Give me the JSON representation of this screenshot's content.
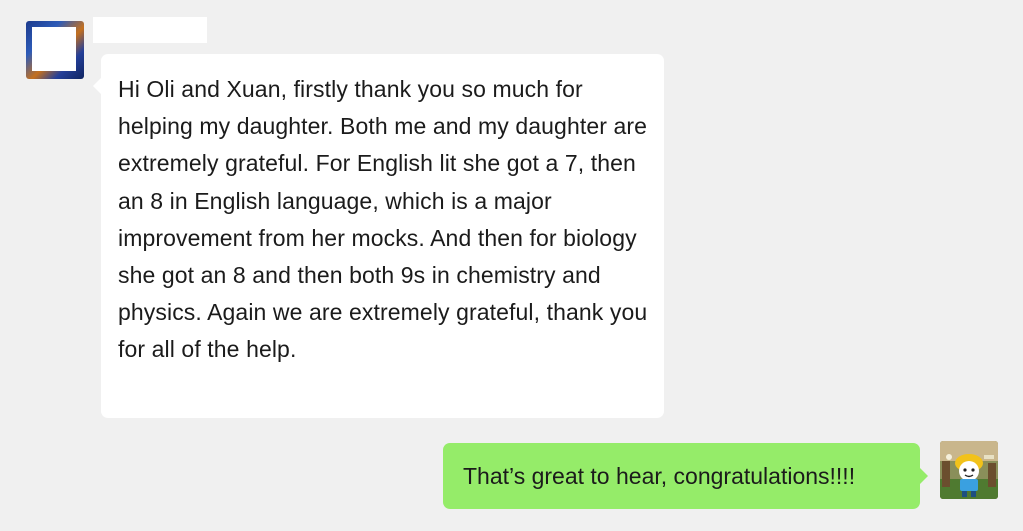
{
  "messages": [
    {
      "direction": "incoming",
      "sender_name": "",
      "text": "Hi Oli and Xuan, firstly thank you so much for helping my daughter. Both me and my daughter are extremely grateful. For English lit she got a 7, then an 8 in English language, which is a major improvement from her mocks. And then for biology she got an 8 and then both 9s in chemistry and physics. Again we are extremely grateful, thank you for all of the help."
    },
    {
      "direction": "outgoing",
      "text": "That’s great to hear, congratulations!!!!"
    }
  ],
  "colors": {
    "background": "#f0f0f0",
    "incoming_bubble": "#ffffff",
    "outgoing_bubble": "#95ec69",
    "text": "#1b1b1b"
  },
  "icons": {
    "incoming_avatar": "user-avatar-icon",
    "outgoing_avatar": "cartoon-character-avatar-icon"
  }
}
